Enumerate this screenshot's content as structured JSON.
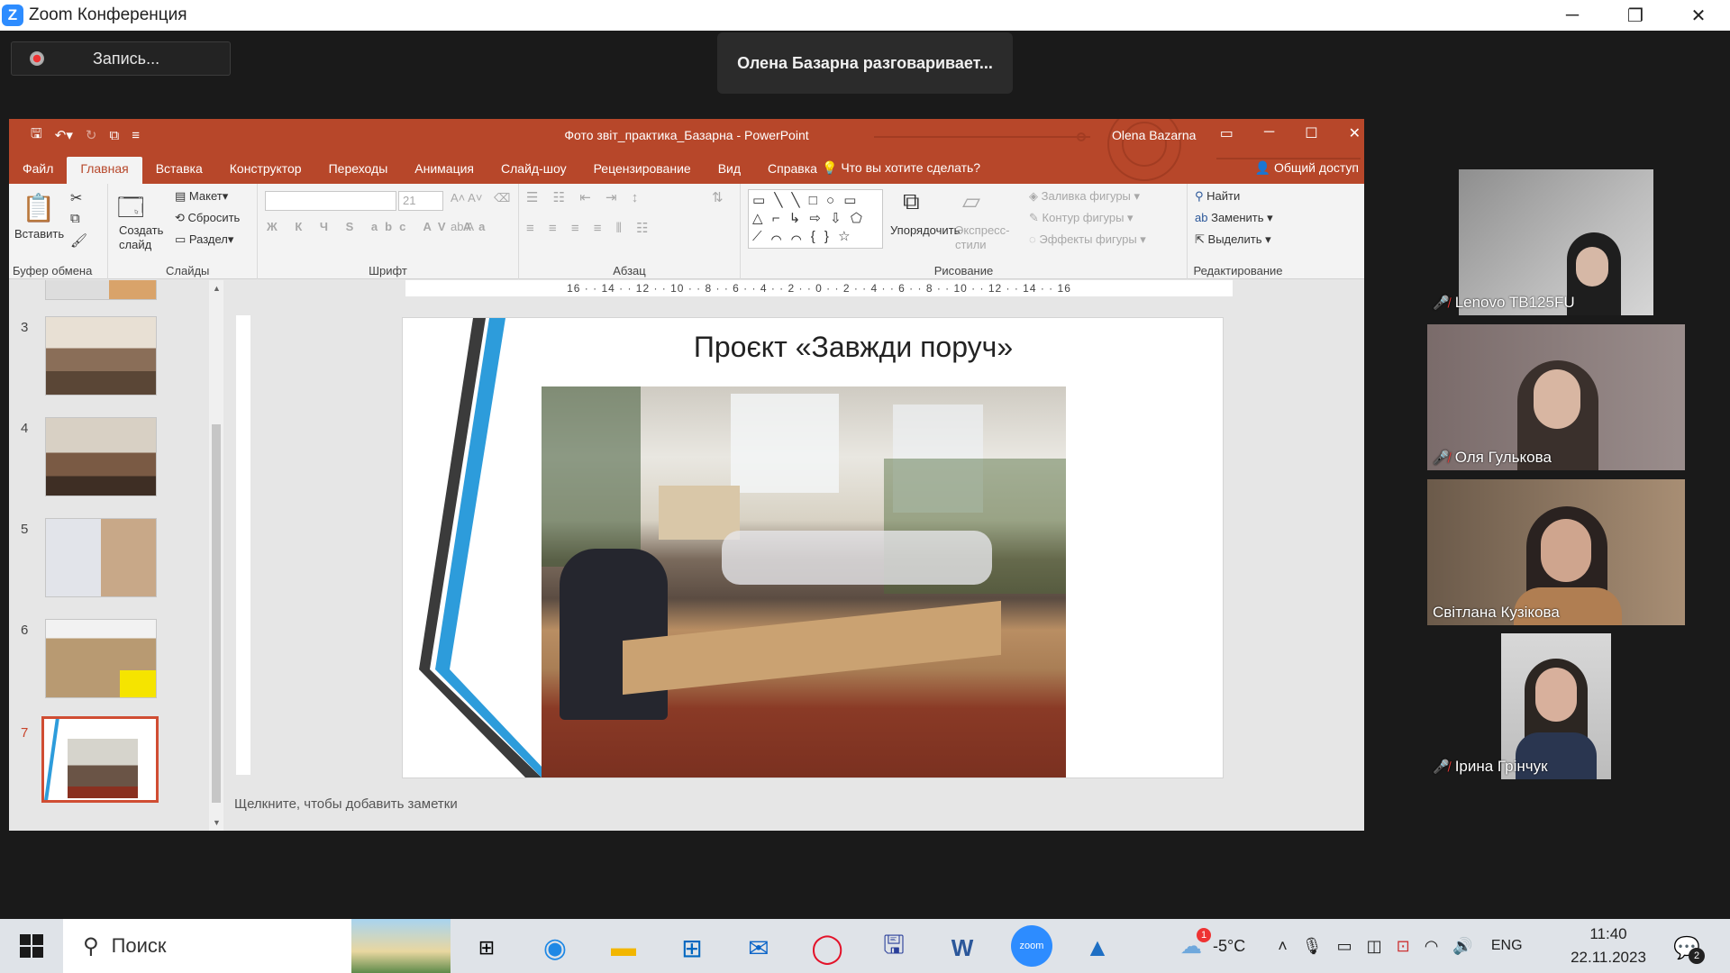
{
  "window": {
    "title": "Zoom Конференция",
    "minimize": "─",
    "restore": "❐",
    "close": "✕"
  },
  "recording": {
    "label": "Запись..."
  },
  "speaking": {
    "text": "Олена Базарна разговаривает..."
  },
  "ppt": {
    "title": "Фото звіт_практика_Базарна  -  PowerPoint",
    "user": "Olena Bazarna",
    "tabs": [
      "Файл",
      "Главная",
      "Вставка",
      "Конструктор",
      "Переходы",
      "Анимация",
      "Слайд-шоу",
      "Рецензирование",
      "Вид",
      "Справка"
    ],
    "tell_me": "Что вы хотите сделать?",
    "share": "Общий доступ",
    "ribbon": {
      "clipboard": {
        "label": "Буфер обмена",
        "paste": "Вставить"
      },
      "slides": {
        "label": "Слайды",
        "new_slide": "Создать слайд",
        "layout": "Макет",
        "reset": "Сбросить",
        "section": "Раздел"
      },
      "font": {
        "label": "Шрифт",
        "size": "21"
      },
      "paragraph": {
        "label": "Абзац"
      },
      "drawing": {
        "label": "Рисование",
        "arrange": "Упорядочить",
        "quick_styles": "Экспресс-стили",
        "fill": "Заливка фигуры",
        "outline": "Контур фигуры",
        "effects": "Эффекты фигуры"
      },
      "editing": {
        "label": "Редактирование",
        "find": "Найти",
        "replace": "Заменить",
        "select": "Выделить"
      }
    },
    "ruler": "16 · · 14 · · 12 · · 10 · · 8 · · 6 · · 4 · · 2 · · 0 · · 2 · · 4 · · 6 · · 8 · · 10 · · 12 · · 14 · · 16",
    "thumbnails": [
      {
        "num": "3"
      },
      {
        "num": "4"
      },
      {
        "num": "5"
      },
      {
        "num": "6"
      },
      {
        "num": "7"
      }
    ],
    "slide_title": "Проєкт «Завжди поруч»",
    "notes_placeholder": "Щелкните, чтобы добавить заметки"
  },
  "participants": [
    {
      "name": "Lenovo TB125FU"
    },
    {
      "name": "Оля Гулькова"
    },
    {
      "name": "Світлана Кузікова"
    },
    {
      "name": "Ірина Грінчук"
    }
  ],
  "taskbar": {
    "search": "Поиск",
    "weather": "-5°C",
    "weather_badge": "1",
    "lang": "ENG",
    "time": "11:40",
    "date": "22.11.2023",
    "notifications": "2"
  }
}
